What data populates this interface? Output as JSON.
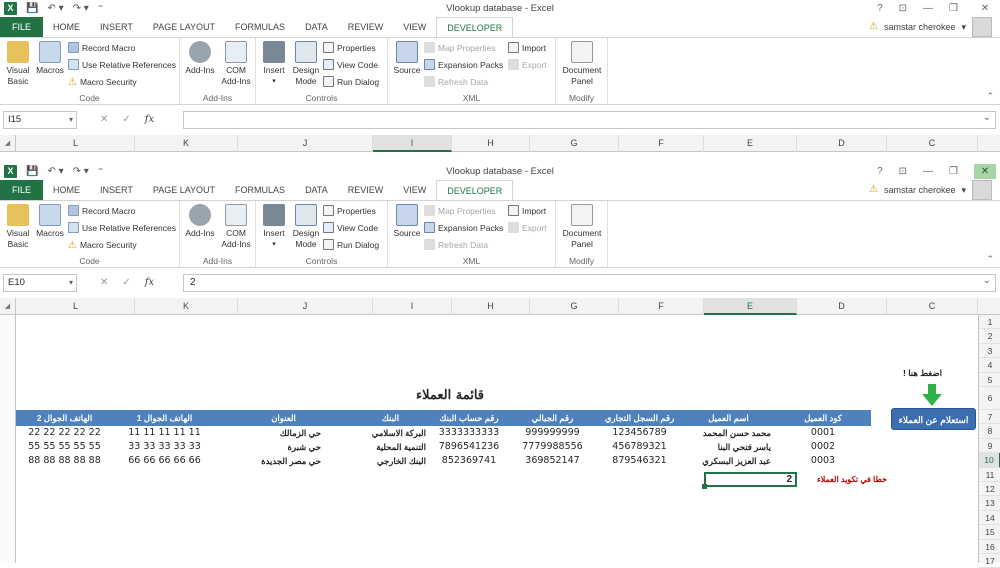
{
  "title": "Vlookup database - Excel",
  "tabs": [
    "FILE",
    "HOME",
    "INSERT",
    "PAGE LAYOUT",
    "FORMULAS",
    "DATA",
    "REVIEW",
    "VIEW",
    "DEVELOPER"
  ],
  "user": "samstar cherokee",
  "window_controls": [
    "?",
    "⊡",
    "—",
    "❐",
    "✕"
  ],
  "ribbon": {
    "code": {
      "label": "Code",
      "visual_basic": "Visual\nBasic",
      "macros": "Macros",
      "record_macro": "Record Macro",
      "use_relative": "Use Relative References",
      "macro_security": "Macro Security"
    },
    "addins": {
      "label": "Add-Ins",
      "addins": "Add-Ins",
      "com_addins": "COM\nAdd-Ins"
    },
    "controls": {
      "label": "Controls",
      "insert": "Insert",
      "design_mode": "Design\nMode",
      "properties": "Properties",
      "view_code": "View Code",
      "run_dialog": "Run Dialog"
    },
    "xml": {
      "label": "XML",
      "source": "Source",
      "map_properties": "Map Properties",
      "expansion_packs": "Expansion Packs",
      "refresh_data": "Refresh Data",
      "import": "Import",
      "export": "Export"
    },
    "modify": {
      "label": "Modify",
      "document_panel": "Document\nPanel"
    }
  },
  "window1": {
    "name_box": "I15",
    "formula": ""
  },
  "window2": {
    "name_box": "E10",
    "formula": "2"
  },
  "columns": [
    "L",
    "K",
    "J",
    "I",
    "H",
    "G",
    "F",
    "E",
    "D",
    "C"
  ],
  "rows": [
    "1",
    "2",
    "3",
    "4",
    "5",
    "6",
    "7",
    "8",
    "9",
    "10",
    "11",
    "12",
    "13",
    "14",
    "15",
    "16",
    "17"
  ],
  "sheet": {
    "title": "قائمة العملاء",
    "hint": "اضغط هنا !",
    "button": "استعلام عن العملاء",
    "error": "خطا في تكويد العملاء",
    "selected_value": "2",
    "headers": [
      "كود العميل",
      "اسم العميل",
      "رقم السجل التجاري",
      "رقم الجبالي",
      "رقم حساب البنك",
      "البنك",
      "العنوان",
      "الهاتف الجوال 1",
      "الهاتف الجوال 2"
    ],
    "rows": [
      [
        "0001",
        "محمد حسن المحمد",
        "123456789",
        "999999999",
        "3333333333",
        "البركة الاسلامي",
        "حي الزمالك",
        "11 11 11 11 11",
        "22 22 22 22 22"
      ],
      [
        "0002",
        "ياسر فتحي البنا",
        "456789321",
        "7779988556",
        "7896541236",
        "التنمية المحلية",
        "حي شبرة",
        "33 33 33 33 33",
        "55 55 55 55 55"
      ],
      [
        "0003",
        "عبد العزيز البسكري",
        "879546321",
        "369852147",
        "852369741",
        "البنك الخارجي",
        "حي مصر الجديدة",
        "66 66 66 66 66",
        "88 88 88 88 88"
      ]
    ]
  },
  "colors": {
    "excel_green": "#217346",
    "header_blue": "#4f81bd",
    "button_blue": "#3b6db1",
    "error_red": "#c00000"
  },
  "icons": [
    "excel-icon",
    "save-icon",
    "undo-icon",
    "redo-icon",
    "customize-icon",
    "warning-icon",
    "down-arrow-icon"
  ]
}
